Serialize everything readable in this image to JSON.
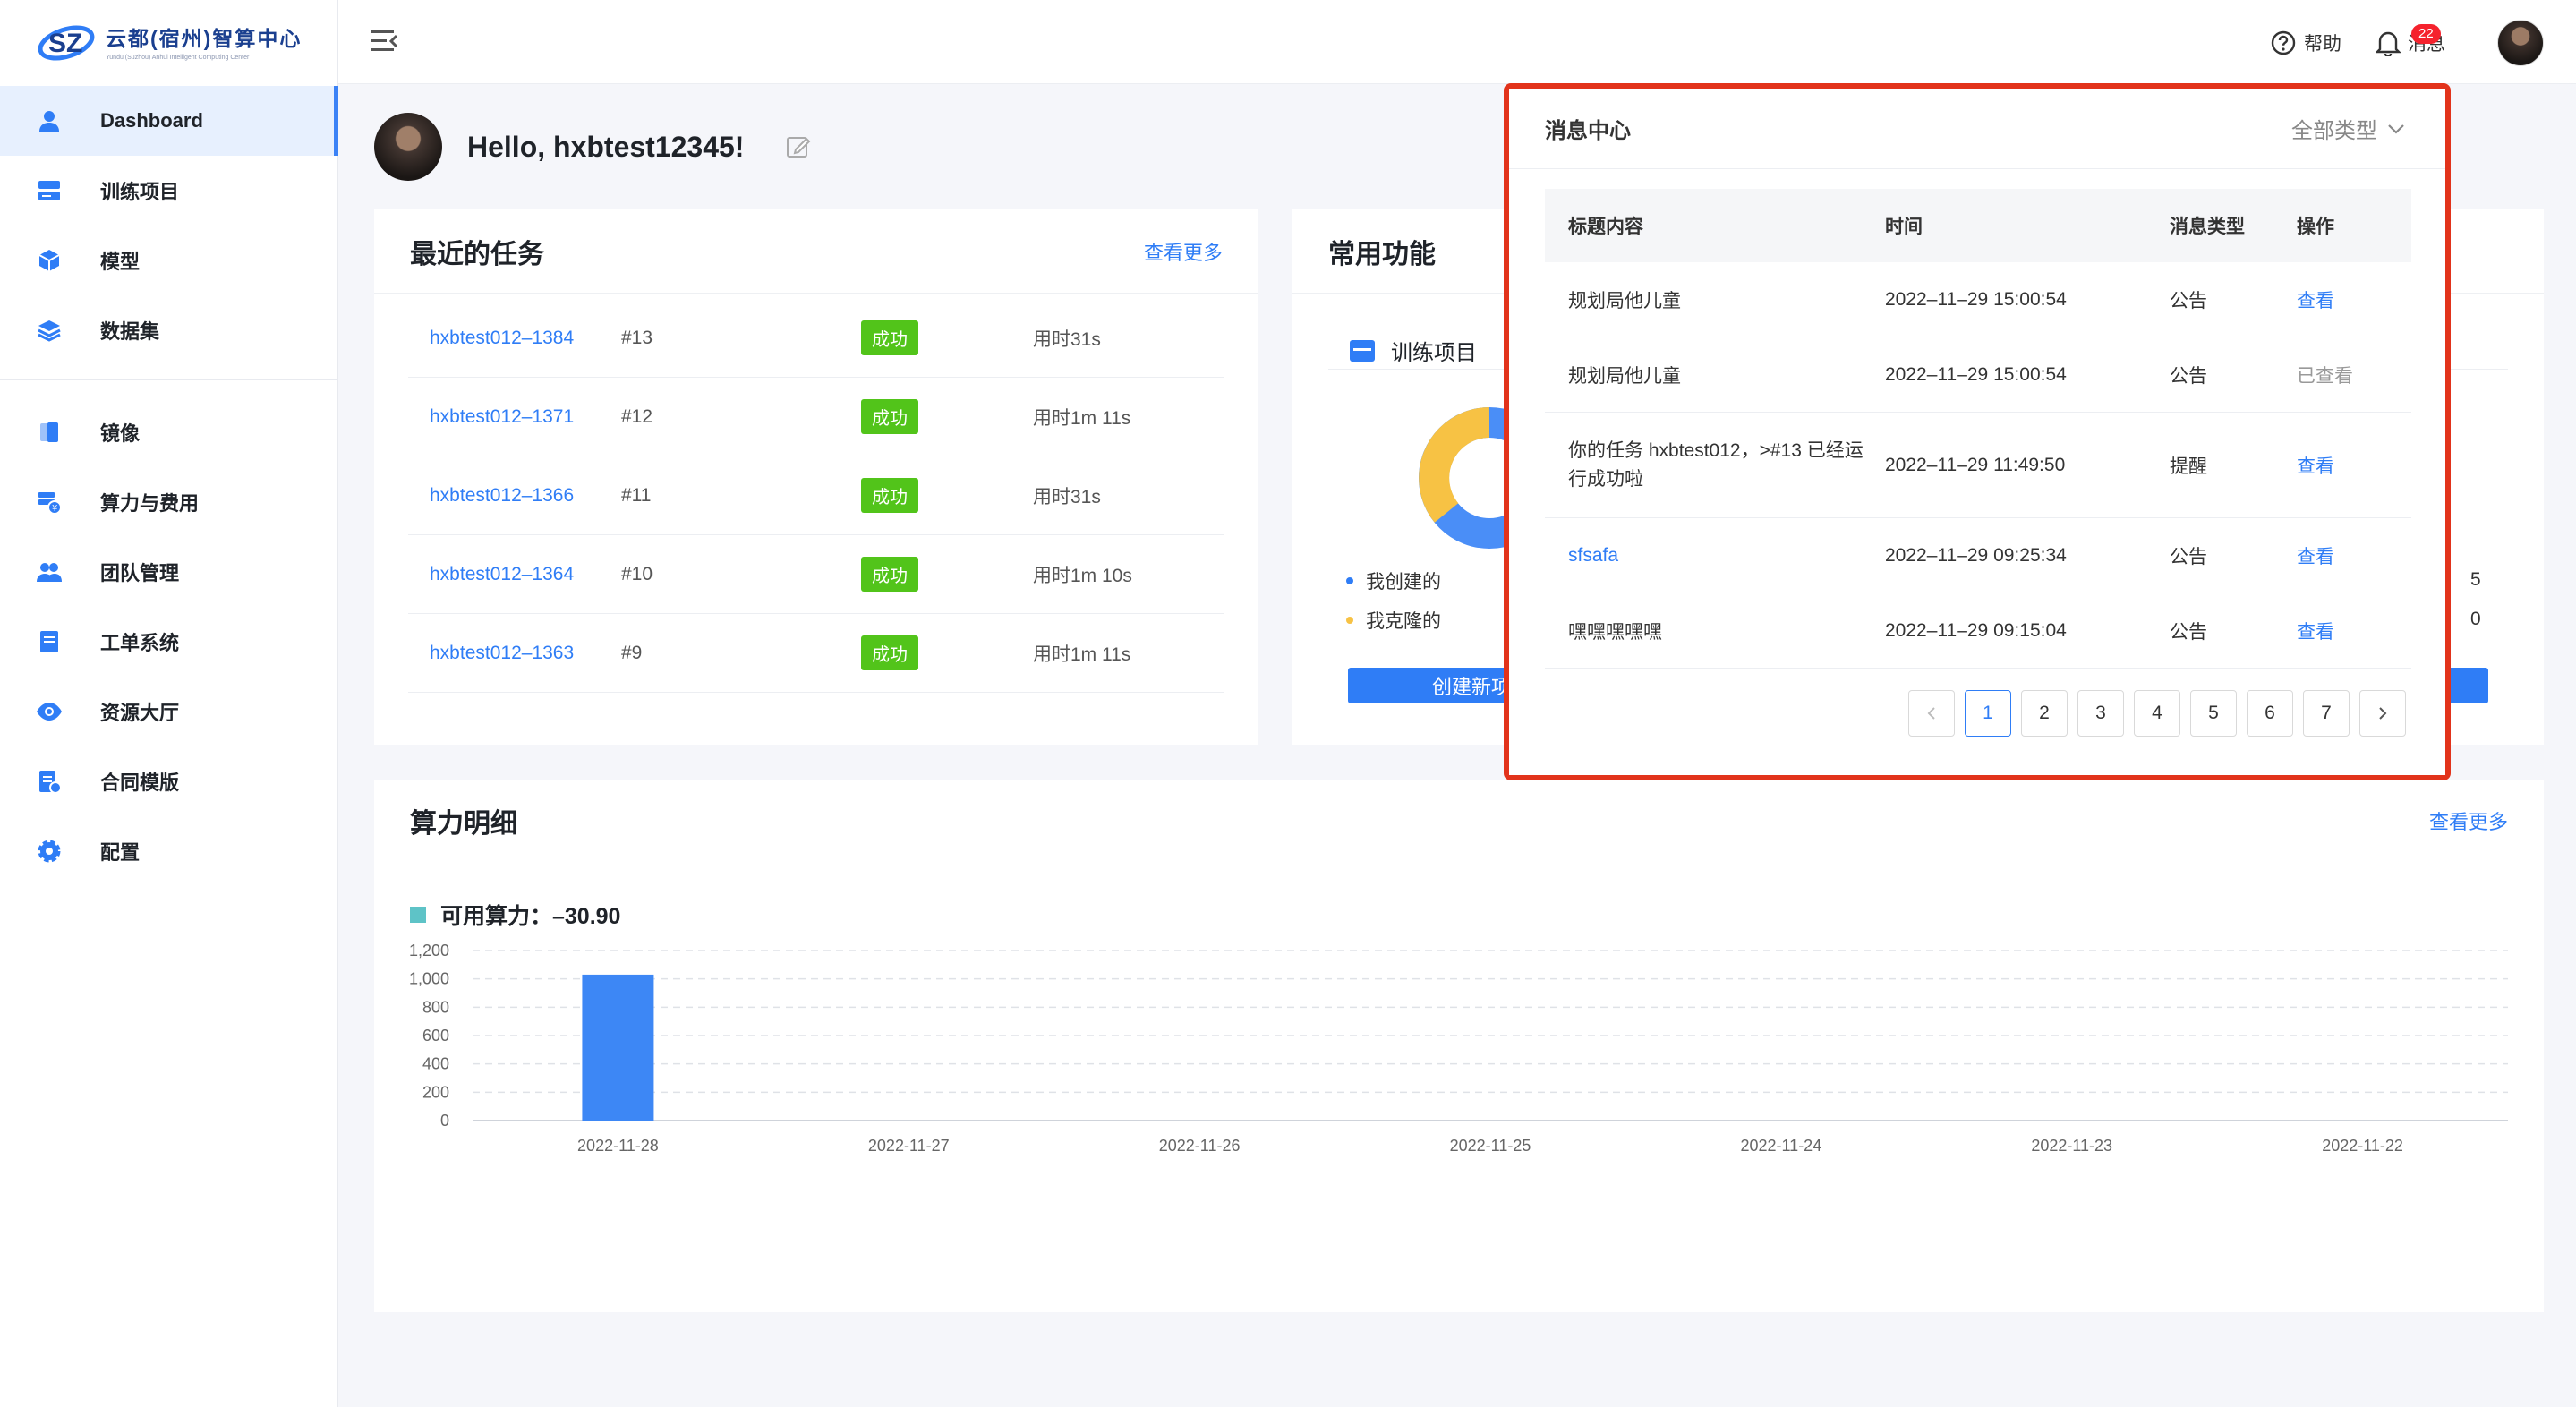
{
  "logo": {
    "title": "云都(宿州)智算中心",
    "subtitle": "Yundu (Suzhou) Anhui Intelligent Computing Center"
  },
  "sidebar": {
    "items": [
      {
        "label": "Dashboard",
        "icon": "user-icon",
        "active": true
      },
      {
        "label": "训练项目",
        "icon": "server-icon"
      },
      {
        "label": "模型",
        "icon": "cube-icon"
      },
      {
        "label": "数据集",
        "icon": "layers-icon"
      },
      {
        "label": "镜像",
        "icon": "image-stack-icon"
      },
      {
        "label": "算力与费用",
        "icon": "compute-cost-icon"
      },
      {
        "label": "团队管理",
        "icon": "team-icon"
      },
      {
        "label": "工单系统",
        "icon": "ticket-icon"
      },
      {
        "label": "资源大厅",
        "icon": "eye-icon"
      },
      {
        "label": "合同模版",
        "icon": "contract-icon"
      },
      {
        "label": "配置",
        "icon": "gear-icon"
      }
    ]
  },
  "header": {
    "help_label": "帮助",
    "messages_label": "消息",
    "messages_badge": "22"
  },
  "greeting": {
    "text": "Hello, hxbtest12345!"
  },
  "recent_tasks": {
    "title": "最近的任务",
    "more_label": "查看更多",
    "rows": [
      {
        "name": "hxbtest012–1384",
        "num": "#13",
        "status": "成功",
        "duration": "用时31s"
      },
      {
        "name": "hxbtest012–1371",
        "num": "#12",
        "status": "成功",
        "duration": "用时1m 11s"
      },
      {
        "name": "hxbtest012–1366",
        "num": "#11",
        "status": "成功",
        "duration": "用时31s"
      },
      {
        "name": "hxbtest012–1364",
        "num": "#10",
        "status": "成功",
        "duration": "用时1m 10s"
      },
      {
        "name": "hxbtest012–1363",
        "num": "#9",
        "status": "成功",
        "duration": "用时1m 11s"
      }
    ]
  },
  "common_functions": {
    "title": "常用功能",
    "sub_title": "训练项目",
    "legend": [
      {
        "label": "我创建的",
        "color": "#2f7df6",
        "value": "5"
      },
      {
        "label": "我克隆的",
        "color": "#f7c244",
        "value": "0"
      }
    ],
    "create_button_label": "创建新项",
    "donut_colors": {
      "primary": "#4a8ef7",
      "secondary": "#f7c244"
    }
  },
  "compute_detail": {
    "title": "算力明细",
    "more_label": "查看更多",
    "available_label": "可用算力：–30.90"
  },
  "chart_data": {
    "type": "bar",
    "categories": [
      "2022-11-28",
      "2022-11-27",
      "2022-11-26",
      "2022-11-25",
      "2022-11-24",
      "2022-11-23",
      "2022-11-22"
    ],
    "values": [
      1030,
      0,
      0,
      0,
      0,
      0,
      0
    ],
    "ylim": [
      0,
      1200
    ],
    "yticks": [
      "0",
      "200",
      "400",
      "600",
      "800",
      "1,000",
      "1,200"
    ],
    "grid": true,
    "bar_color": "#3d87f5"
  },
  "message_center": {
    "title": "消息中心",
    "filter_label": "全部类型",
    "columns": [
      "标题内容",
      "时间",
      "消息类型",
      "操作"
    ],
    "rows": [
      {
        "title": "规划局他儿童",
        "time": "2022–11–29 15:00:54",
        "type": "公告",
        "action": "查看",
        "viewed": false
      },
      {
        "title": "规划局他儿童",
        "time": "2022–11–29 15:00:54",
        "type": "公告",
        "action": "已查看",
        "viewed": true
      },
      {
        "title": "你的任务 hxbtest012，>#13 已经运行成功啦",
        "time": "2022–11–29 11:49:50",
        "type": "提醒",
        "action": "查看",
        "viewed": false
      },
      {
        "title": "sfsafa",
        "time": "2022–11–29 09:25:34",
        "type": "公告",
        "action": "查看",
        "viewed": false,
        "is_link": true
      },
      {
        "title": "嘿嘿嘿嘿嘿",
        "time": "2022–11–29 09:15:04",
        "type": "公告",
        "action": "查看",
        "viewed": false
      }
    ],
    "pages": [
      "1",
      "2",
      "3",
      "4",
      "5",
      "6",
      "7"
    ],
    "current_page": "1"
  }
}
